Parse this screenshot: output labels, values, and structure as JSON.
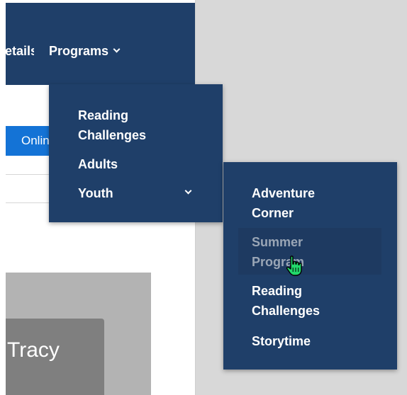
{
  "nav": {
    "details_label": "Details",
    "programs_label": "Programs",
    "programs_chevron_icon": "chevron-down-icon"
  },
  "content": {
    "online_button_label": "Online",
    "image_caption": "Tracy"
  },
  "programs_menu": {
    "items": [
      {
        "label": "Reading Challenges"
      },
      {
        "label": "Adults"
      },
      {
        "label": "Youth",
        "has_submenu": true
      }
    ]
  },
  "youth_submenu": {
    "items": [
      {
        "label": "Adventure Corner"
      },
      {
        "label": "Summer Program",
        "state": "hover"
      },
      {
        "label": "Reading Challenges"
      },
      {
        "label": "Storytime"
      }
    ]
  },
  "colors": {
    "nav_bg": "#1f3f69",
    "menu_text": "#ffffff",
    "hover_text": "#9aa6b6",
    "button_blue": "#1473d6",
    "backdrop_grey": "#d8d8d8"
  },
  "cursor": "hand-pointer-icon"
}
